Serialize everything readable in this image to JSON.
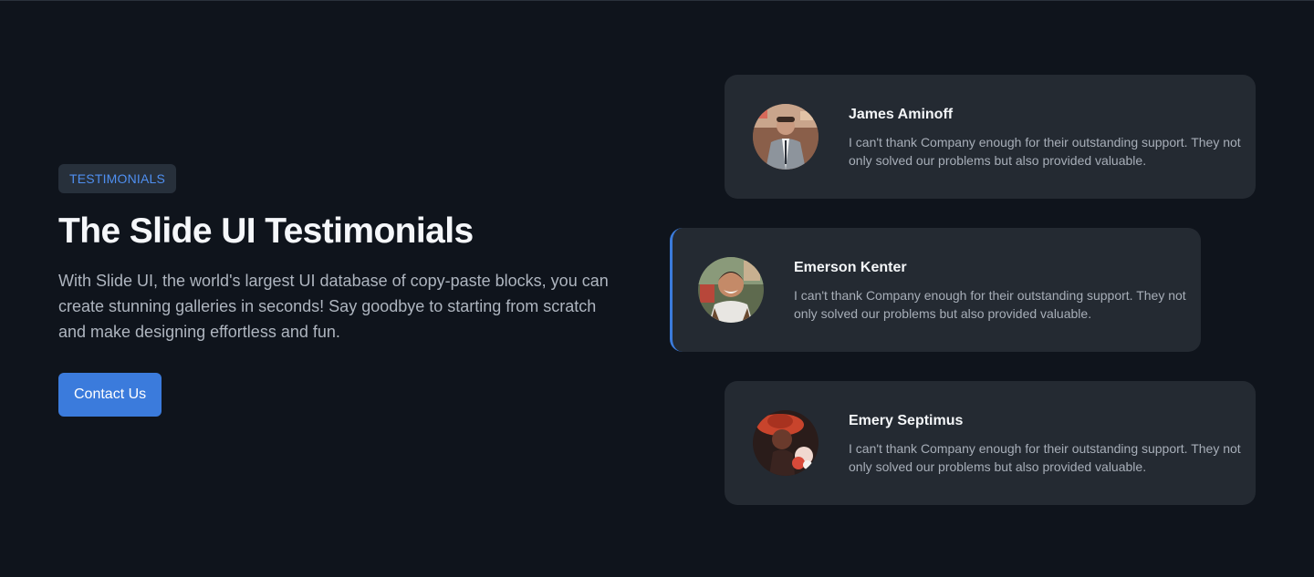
{
  "hero": {
    "badge": "TESTIMONIALS",
    "title": "The Slide UI Testimonials",
    "description": "With Slide UI, the world's largest UI database of copy-paste blocks, you can create stunning galleries in seconds! Say goodbye to starting from scratch and make designing effortless and fun.",
    "cta_label": "Contact Us"
  },
  "testimonials": [
    {
      "name": "James Aminoff",
      "quote": "I can't thank Company enough for their outstanding support. They not only solved our problems but also provided valuable.",
      "avatar": "man-in-suit-photo"
    },
    {
      "name": "Emerson Kenter",
      "quote": "I can't thank Company enough for their outstanding support. They not only solved our problems but also provided valuable.",
      "avatar": "smiling-man-photo",
      "active": true
    },
    {
      "name": "Emery Septimus",
      "quote": "I can't thank Company enough for their outstanding support. They not only solved our problems but also provided valuable.",
      "avatar": "woman-red-hat-photo"
    }
  ],
  "colors": {
    "background": "#0f141c",
    "card": "#242a32",
    "accent": "#3b7bdc",
    "badge_text": "#4f8ff0"
  }
}
